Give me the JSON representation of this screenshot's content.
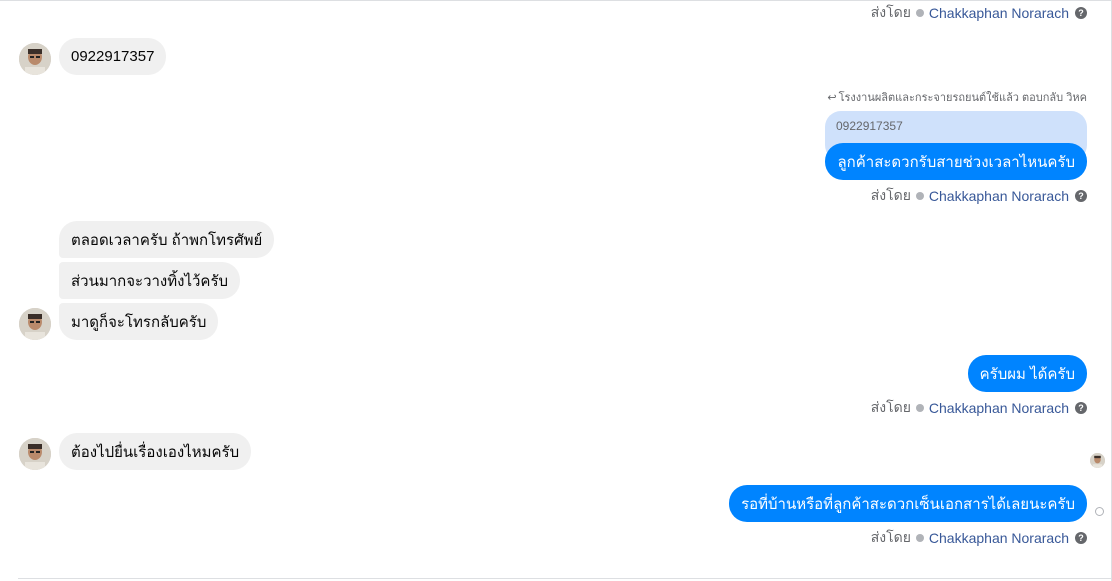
{
  "thread": {
    "sent_by_prefix": "ส่งโดย",
    "sender_name": "Chakkaphan Norarach",
    "help_glyph": "?",
    "reply_header": "โรงงานผลิตและกระจายรถยนต์ใช้แล้ว ตอบกลับ วิหค",
    "quoted_text": "0922917357"
  },
  "messages": {
    "in_phone": "0922917357",
    "out_reply": "ลูกค้าสะดวกรับสายช่วงเวลาไหนครับ",
    "in_1": "ตลอดเวลาครับ ถ้าพกโทรศัพย์",
    "in_2": "ส่วนมากจะวางทิ้งไว้ครับ",
    "in_3": "มาดูก็จะโทรกลับครับ",
    "out_2": "ครับผม ได้ครับ",
    "in_4": "ต้องไปยื่นเรื่องเองไหมครับ",
    "out_3": "รอที่บ้านหรือที่ลูกค้าสะดวกเซ็นเอกสารได้เลยนะครับ"
  },
  "colors": {
    "outgoing": "#0084ff",
    "incoming": "#f0f0f0",
    "quote_bg": "#cfe1fb",
    "sender_link": "#385898"
  }
}
